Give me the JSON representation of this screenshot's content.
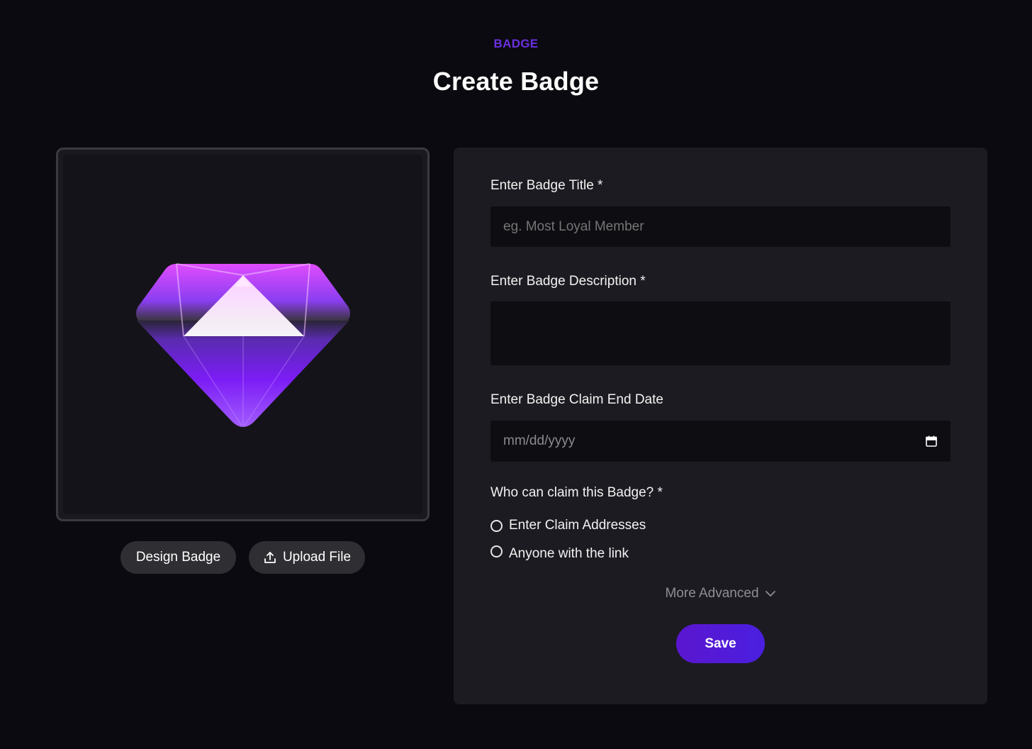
{
  "header": {
    "eyebrow": "BADGE",
    "title": "Create Badge"
  },
  "preview": {
    "icon": "diamond-gem-icon",
    "design_label": "Design Badge",
    "upload_label": "Upload File",
    "upload_icon": "upload-icon"
  },
  "form": {
    "title_label": "Enter Badge Title *",
    "title_placeholder": "eg. Most Loyal Member",
    "description_label": "Enter Badge Description *",
    "description_value": "",
    "date_label": "Enter Badge Claim End Date",
    "date_placeholder": "mm/dd/yyyy",
    "date_icon": "calendar-icon",
    "claim_label": "Who can claim this Badge? *",
    "claim_options": [
      {
        "label": "Enter Claim Addresses",
        "selected": false
      },
      {
        "label": "Anyone with the link",
        "selected": false
      }
    ],
    "more_label": "More Advanced",
    "more_icon": "chevron-down-icon",
    "save_label": "Save"
  },
  "colors": {
    "background": "#0b0a10",
    "card": "#1c1b21",
    "accent": "#5b16cf",
    "eyebrow": "#6b2fe0"
  }
}
